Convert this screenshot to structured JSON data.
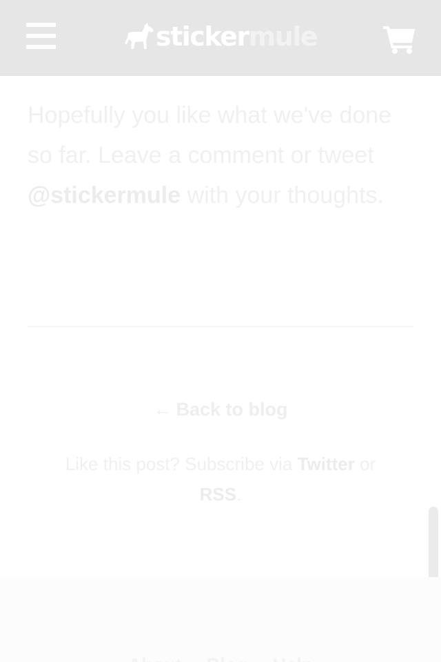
{
  "header": {
    "logo_text_part1": "sticker",
    "logo_text_part2": "mule",
    "menu_icon": "hamburger-menu-icon",
    "cart_icon": "shopping-cart-icon"
  },
  "article": {
    "text_before": "Hopefully you like what we've done so far. Leave a comment or tweet ",
    "handle": "@stickermule",
    "text_after": " with your thoughts."
  },
  "navigation": {
    "back_arrow": "←",
    "back_label": "Back to blog"
  },
  "subscribe": {
    "text_before": "Like this post? Subscribe via ",
    "twitter_label": "Twitter",
    "text_middle": " or ",
    "rss_label": "RSS",
    "text_after": "."
  },
  "footer": {
    "links": [
      "About",
      "Blog",
      "Help"
    ]
  },
  "colors": {
    "header_bg": "#e6e6e6",
    "text": "#f0f0f0",
    "footer_bg": "#fcfcfc"
  }
}
